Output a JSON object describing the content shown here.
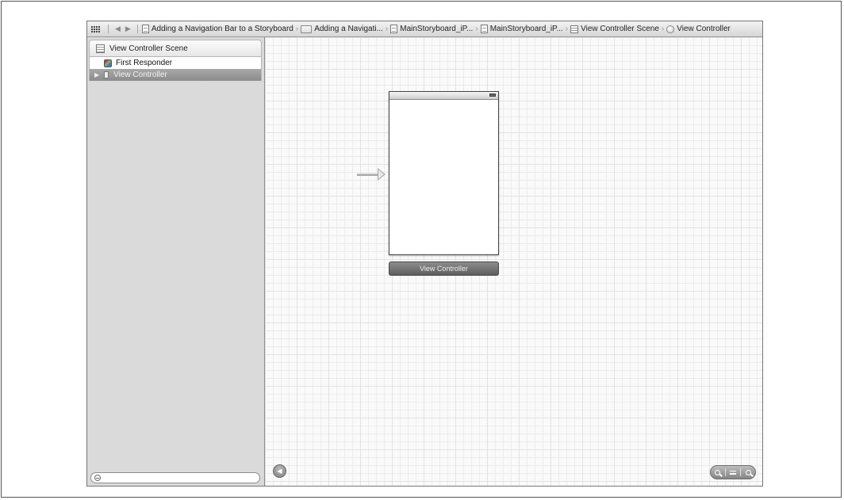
{
  "jumpbar": {
    "items": [
      {
        "label": "Adding a Navigation Bar to a Storyboard",
        "icon": "project-document-icon"
      },
      {
        "label": "Adding a Navigati...",
        "icon": "folder-icon"
      },
      {
        "label": "MainStoryboard_iP...",
        "icon": "storyboard-file-icon"
      },
      {
        "label": "MainStoryboard_iP...",
        "icon": "storyboard-file-icon"
      },
      {
        "label": "View Controller Scene",
        "icon": "scene-icon"
      },
      {
        "label": "View Controller",
        "icon": "view-controller-icon"
      }
    ]
  },
  "sidebar": {
    "scene_title": "View Controller Scene",
    "tree": [
      {
        "label": "First Responder",
        "icon": "first-responder-cube-icon",
        "selected": false
      },
      {
        "label": "View Controller",
        "icon": "view-controller-icon",
        "selected": true
      }
    ],
    "filter_placeholder": ""
  },
  "canvas": {
    "scene_label": "View Controller"
  },
  "colors": {
    "selected_row": "#8c8c8c",
    "canvas_bg": "#fafafa",
    "scene_dock": "#6f6f6f"
  }
}
